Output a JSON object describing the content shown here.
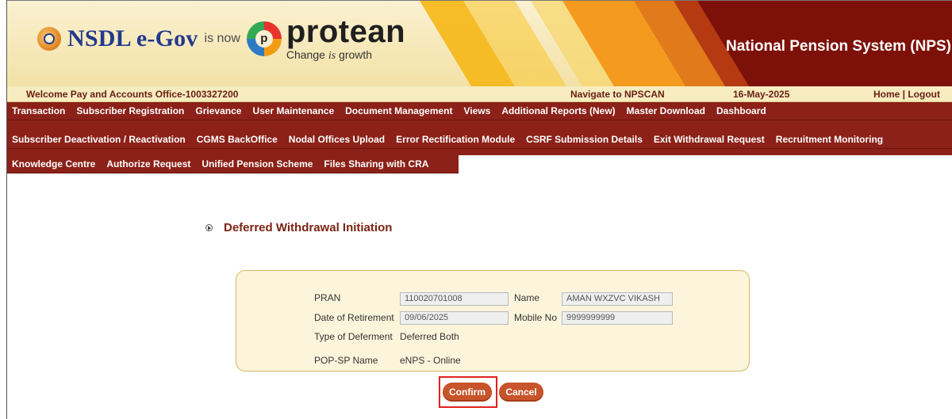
{
  "header": {
    "nsdl_logo_text": "NSDL e-Gov",
    "is_now_text": "is now",
    "protean_logo_text": "protean",
    "tagline_pre": "Change",
    "tagline_is": "is",
    "tagline_post": "growth",
    "site_title": "National Pension System (NPS)"
  },
  "info_bar": {
    "welcome": "Welcome Pay and Accounts Office-1003327200",
    "navigate": "Navigate to NPSCAN",
    "date": "16-May-2025",
    "home_logout": "Home | Logout"
  },
  "menu": {
    "row1": [
      "Transaction",
      "Subscriber Registration",
      "Grievance",
      "User Maintenance",
      "Document Management",
      "Views",
      "Additional Reports (New)",
      "Master Download",
      "Dashboard"
    ],
    "row2": [
      "Subscriber Deactivation / Reactivation",
      "CGMS BackOffice",
      "Nodal Offices Upload",
      "Error Rectification Module",
      "CSRF Submission Details",
      "Exit Withdrawal Request",
      "Recruitment Monitoring"
    ],
    "row3": [
      "Knowledge Centre",
      "Authorize Request",
      "Unified Pension Scheme",
      "Files Sharing with CRA"
    ]
  },
  "page": {
    "heading": "Deferred Withdrawal Initiation"
  },
  "form": {
    "pran_label": "PRAN",
    "pran_value": "110020701008",
    "name_label": "Name",
    "name_value": "AMAN WXZVC VIKASH",
    "dor_label": "Date of Retirement",
    "dor_value": "09/06/2025",
    "mobile_label": "Mobile No",
    "mobile_value": "9999999999",
    "deferment_label": "Type of Deferment",
    "deferment_value": "Deferred Both",
    "popsp_label": "POP-SP Name",
    "popsp_value": "eNPS - Online"
  },
  "buttons": {
    "confirm": "Confirm",
    "cancel": "Cancel"
  },
  "colors": {
    "menu_bg": "#8b2118",
    "accent_button": "#c7542a",
    "highlight_box": "#e0201b",
    "heading_text": "#7a2414"
  }
}
